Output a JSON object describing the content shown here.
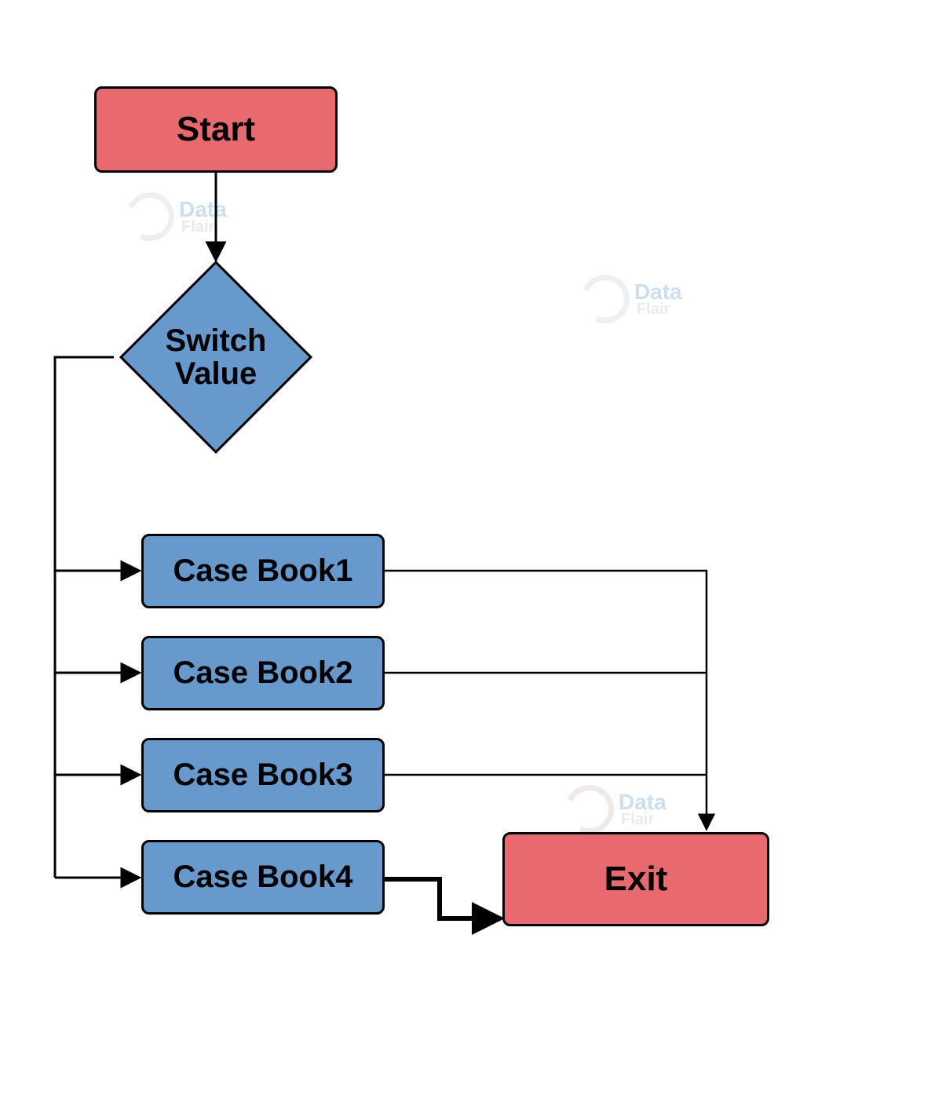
{
  "nodes": {
    "start": {
      "label": "Start"
    },
    "decision": {
      "line1": "Switch",
      "line2": "Value"
    },
    "case1": {
      "label": "Case Book1"
    },
    "case2": {
      "label": "Case Book2"
    },
    "case3": {
      "label": "Case Book3"
    },
    "case4": {
      "label": "Case Book4"
    },
    "exit": {
      "label": "Exit"
    }
  },
  "watermark": {
    "brand_top": "Data",
    "brand_bottom": "Flair"
  },
  "colors": {
    "red_fill": "#e76a6f",
    "blue_fill": "#6799cc",
    "stroke": "#000000",
    "wm_blue": "#6da6d6",
    "wm_red": "#c96a6f"
  },
  "edges": [
    {
      "from": "start",
      "to": "decision"
    },
    {
      "from": "decision",
      "to": "case1"
    },
    {
      "from": "decision",
      "to": "case2"
    },
    {
      "from": "decision",
      "to": "case3"
    },
    {
      "from": "decision",
      "to": "case4"
    },
    {
      "from": "case1",
      "to": "exit"
    },
    {
      "from": "case2",
      "to": "exit"
    },
    {
      "from": "case3",
      "to": "exit"
    },
    {
      "from": "case4",
      "to": "exit"
    }
  ]
}
